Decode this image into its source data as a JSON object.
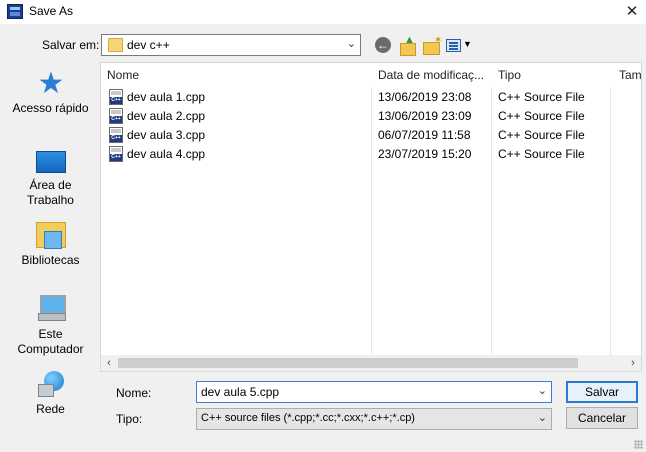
{
  "window": {
    "title": "Save As"
  },
  "toolbar": {
    "save_in_label": "Salvar em:",
    "current_folder": "dev c++"
  },
  "places": [
    {
      "label": "Acesso rápido",
      "icon": "quick-access-star-icon"
    },
    {
      "label": "Área de Trabalho",
      "icon": "desktop-icon"
    },
    {
      "label": "Bibliotecas",
      "icon": "libraries-icon"
    },
    {
      "label": "Este Computador",
      "icon": "computer-icon"
    },
    {
      "label": "Rede",
      "icon": "network-icon"
    }
  ],
  "columns": {
    "name": "Nome",
    "date": "Data de modificaç...",
    "type": "Tipo",
    "size": "Tam"
  },
  "files": [
    {
      "name": "dev aula 1.cpp",
      "date": "13/06/2019 23:08",
      "type": "C++ Source File"
    },
    {
      "name": "dev aula 2.cpp",
      "date": "13/06/2019 23:09",
      "type": "C++ Source File"
    },
    {
      "name": "dev aula 3.cpp",
      "date": "06/07/2019 11:58",
      "type": "C++ Source File"
    },
    {
      "name": "dev aula 4.cpp",
      "date": "23/07/2019 15:20",
      "type": "C++ Source File"
    }
  ],
  "form": {
    "name_label": "Nome:",
    "name_value": "dev aula 5.cpp",
    "type_label": "Tipo:",
    "type_value": "C++ source files (*.cpp;*.cc;*.cxx;*.c++;*.cp)"
  },
  "buttons": {
    "save": "Salvar",
    "cancel": "Cancelar"
  }
}
